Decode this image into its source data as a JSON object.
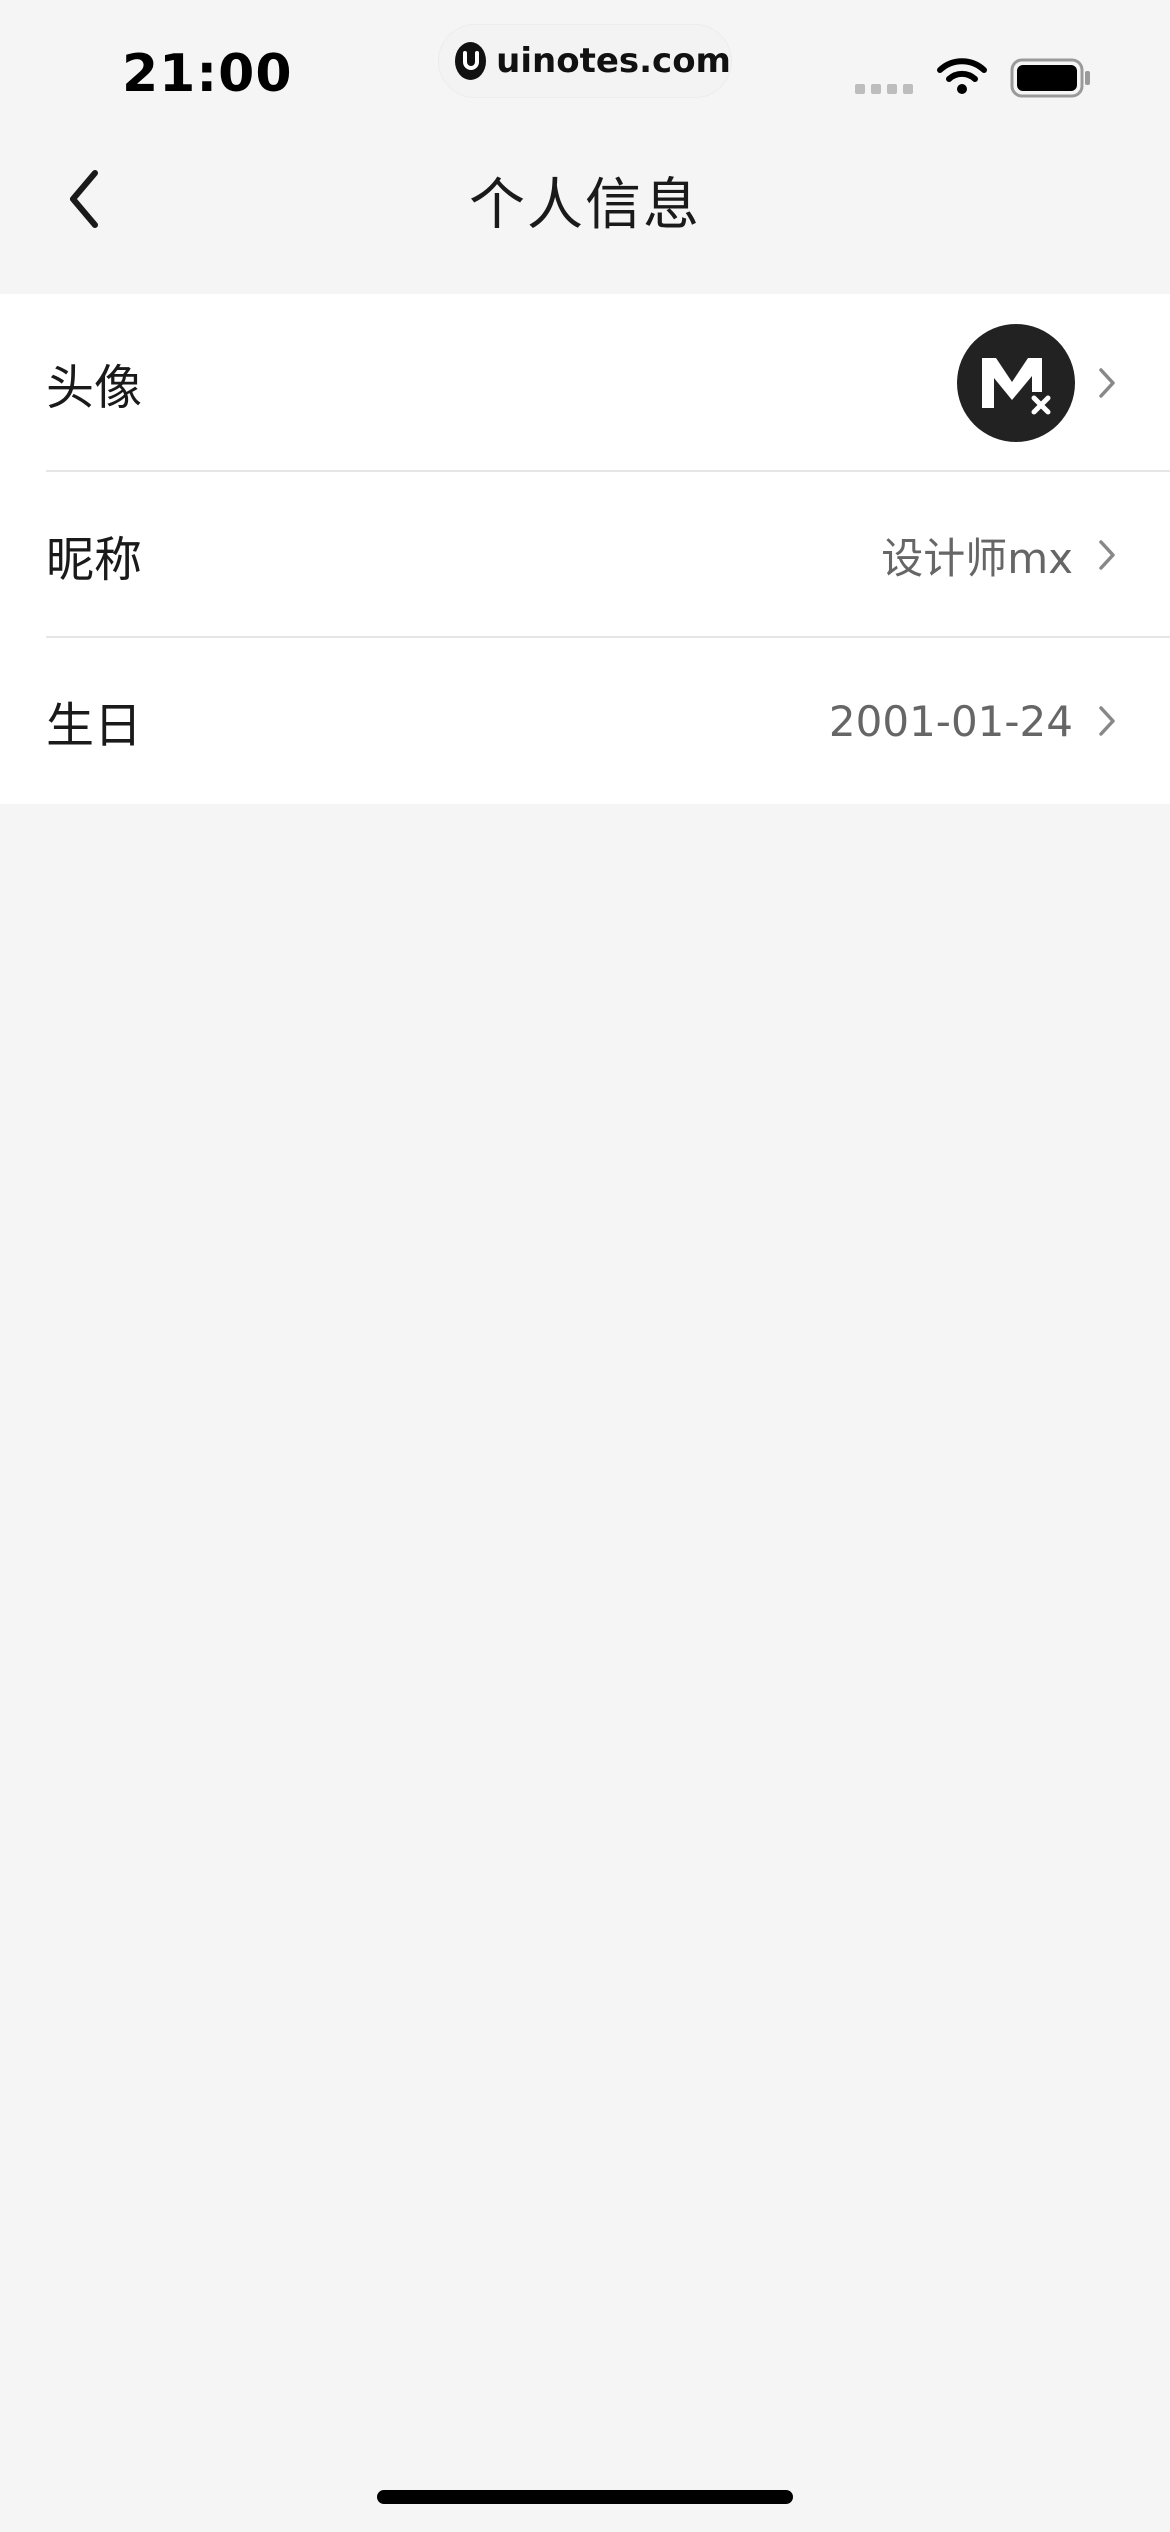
{
  "status_bar": {
    "time": "21:00",
    "url": "uinotes.com"
  },
  "nav": {
    "title": "个人信息"
  },
  "rows": [
    {
      "label": "头像",
      "type": "avatar"
    },
    {
      "label": "昵称",
      "value": "设计师mx"
    },
    {
      "label": "生日",
      "value": "2001-01-24"
    }
  ],
  "colors": {
    "background": "#f5f5f5",
    "card": "#ffffff",
    "text_primary": "#1a1a1a",
    "text_secondary": "#666666",
    "avatar_bg": "#222222"
  }
}
